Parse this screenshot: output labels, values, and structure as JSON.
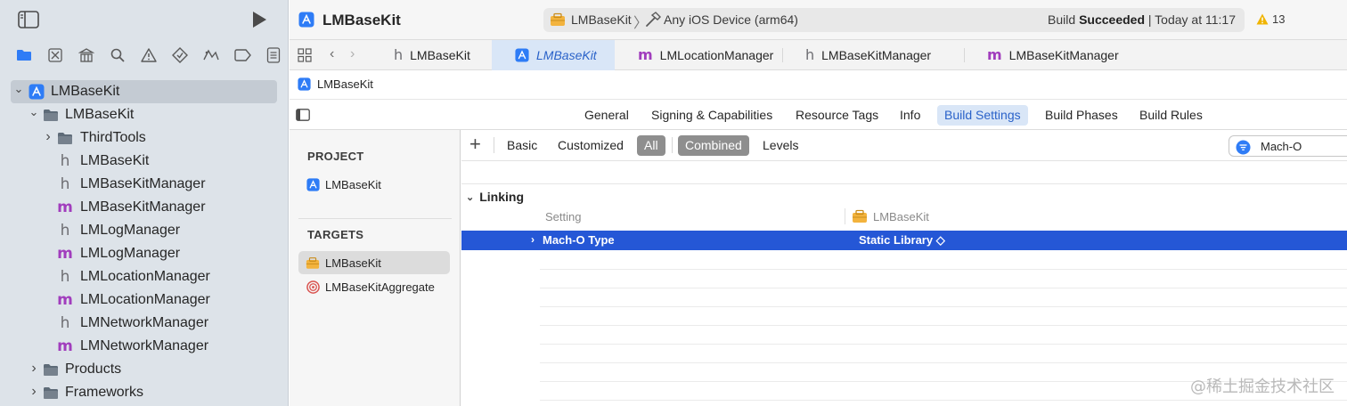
{
  "window": {
    "title": "LMBaseKit",
    "scheme": "LMBaseKit",
    "destination": "Any iOS Device (arm64)",
    "status_prefix": "Build ",
    "status_bold": "Succeeded",
    "status_suffix": " | Today at 11:17",
    "warning_count": "13"
  },
  "navigator": {
    "tree": [
      {
        "label": "LMBaseKit",
        "kind": "project",
        "depth": 0,
        "expanded": true,
        "selected": true
      },
      {
        "label": "LMBaseKit",
        "kind": "folder",
        "depth": 1,
        "expanded": true
      },
      {
        "label": "ThirdTools",
        "kind": "folder",
        "depth": 2,
        "expanded": false
      },
      {
        "label": "LMBaseKit",
        "kind": "h",
        "depth": 2
      },
      {
        "label": "LMBaseKitManager",
        "kind": "h",
        "depth": 2
      },
      {
        "label": "LMBaseKitManager",
        "kind": "m",
        "depth": 2
      },
      {
        "label": "LMLogManager",
        "kind": "h",
        "depth": 2
      },
      {
        "label": "LMLogManager",
        "kind": "m",
        "depth": 2
      },
      {
        "label": "LMLocationManager",
        "kind": "h",
        "depth": 2
      },
      {
        "label": "LMLocationManager",
        "kind": "m",
        "depth": 2
      },
      {
        "label": "LMNetworkManager",
        "kind": "h",
        "depth": 2
      },
      {
        "label": "LMNetworkManager",
        "kind": "m",
        "depth": 2
      },
      {
        "label": "Products",
        "kind": "folder",
        "depth": 1,
        "expanded": false
      },
      {
        "label": "Frameworks",
        "kind": "folder",
        "depth": 1,
        "expanded": false
      }
    ]
  },
  "editor_tabs": [
    {
      "label": "LMBaseKit",
      "kind": "h",
      "active": false
    },
    {
      "label": "LMBaseKit",
      "kind": "project",
      "active": true
    },
    {
      "label": "LMLocationManager",
      "kind": "m",
      "active": false
    },
    {
      "label": "LMBaseKitManager",
      "kind": "h",
      "active": false
    },
    {
      "label": "LMBaseKitManager",
      "kind": "m",
      "active": false
    }
  ],
  "breadcrumb": "LMBaseKit",
  "settings_tabs": [
    "General",
    "Signing & Capabilities",
    "Resource Tags",
    "Info",
    "Build Settings",
    "Build Phases",
    "Build Rules"
  ],
  "active_settings_tab": "Build Settings",
  "project_panel": {
    "project_header": "PROJECT",
    "project_item": "LMBaseKit",
    "targets_header": "TARGETS",
    "targets": [
      {
        "label": "LMBaseKit",
        "kind": "framework",
        "selected": true
      },
      {
        "label": "LMBaseKitAggregate",
        "kind": "aggregate",
        "selected": false
      }
    ]
  },
  "build_toolbar": {
    "plus": "+",
    "scope_buttons": [
      "Basic",
      "Customized",
      "All"
    ],
    "active_scope": "All",
    "view_buttons": [
      "Combined",
      "Levels"
    ],
    "active_view": "Combined",
    "filter_value": "Mach-O"
  },
  "build_settings": {
    "section": "Linking",
    "col_setting": "Setting",
    "col_target": "LMBaseKit",
    "rows": [
      {
        "name": "Mach-O Type",
        "value": "Static Library ◇"
      }
    ]
  },
  "watermark": "@稀土掘金技术社区",
  "colors": {
    "accent": "#2557d6",
    "selection_light": "#d9e6f7",
    "m_file": "#a13dbd",
    "warning": "#f0b400",
    "framework": "#f3b33d"
  }
}
